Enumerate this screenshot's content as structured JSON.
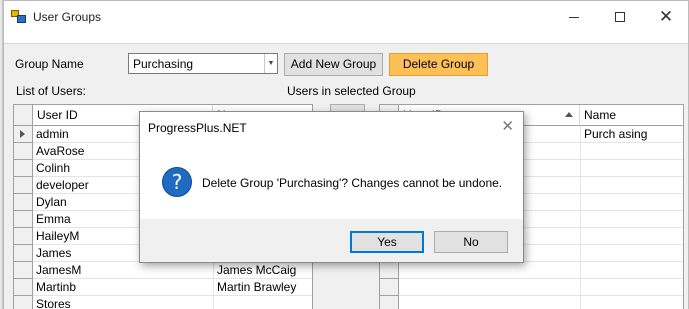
{
  "window": {
    "title": "User Groups",
    "minimize_icon": "minimize-icon",
    "maximize_icon": "maximize-icon",
    "close_icon": "close-icon"
  },
  "form": {
    "group_name_label": "Group Name",
    "group_name_value": "Purchasing",
    "add_group_label": "Add New Group",
    "delete_group_label": "Delete Group",
    "list_of_users_label": "List of Users:",
    "users_in_group_label": "Users in selected Group"
  },
  "users_grid": {
    "columns": [
      "User ID",
      "N"
    ],
    "rows": [
      {
        "user_id": "admin",
        "name": ""
      },
      {
        "user_id": "AvaRose",
        "name": ""
      },
      {
        "user_id": "Colinh",
        "name": ""
      },
      {
        "user_id": "developer",
        "name": ""
      },
      {
        "user_id": "Dylan",
        "name": ""
      },
      {
        "user_id": "Emma",
        "name": ""
      },
      {
        "user_id": "HaileyM",
        "name": ""
      },
      {
        "user_id": "James",
        "name": ""
      },
      {
        "user_id": "JamesM",
        "name": "James McCaig"
      },
      {
        "user_id": "Martinb",
        "name": "Martin Brawley"
      },
      {
        "user_id": "Stores",
        "name": ""
      }
    ]
  },
  "group_grid": {
    "columns": [
      "User ID",
      "Name"
    ],
    "rows": [
      {
        "user_id": "",
        "name": "Purch asing"
      }
    ]
  },
  "dialog": {
    "title": "ProgressPlus.NET",
    "message": "Delete Group 'Purchasing'? Changes cannot be undone.",
    "icon": "question-icon",
    "yes_label": "Yes",
    "no_label": "No"
  },
  "colors": {
    "delete_button": "#fdbf58",
    "question_icon": "#1f6bc1",
    "default_button_border": "#0078d7"
  }
}
